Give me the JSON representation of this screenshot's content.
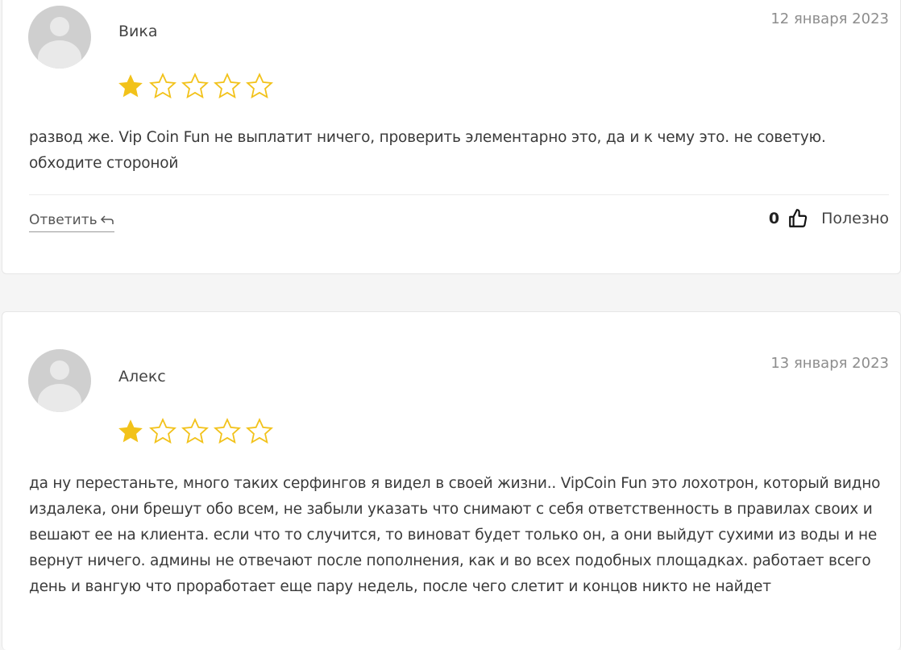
{
  "reviews": [
    {
      "author": "Вика",
      "date": "12 января 2023",
      "rating": 1,
      "max_rating": 5,
      "text": "развод же. Vip Coin Fun не выплатит ничего, проверить элементарно это, да и к чему это. не советую. обходите стороной",
      "reply_label": "Ответить",
      "useful_count": "0",
      "useful_label": "Полезно"
    },
    {
      "author": "Алекс",
      "date": "13 января 2023",
      "rating": 1,
      "max_rating": 5,
      "text": "да ну перестаньте, много таких серфингов я видел в своей жизни.. VipCoin Fun это лохотрон, который видно издалека, они брешут обо всем, не забыли указать что снимают с себя ответственность в правилах своих и вешают ее на клиента. если что то случится, то виноват будет только он, а они выйдут сухими из воды и не вернут ничего. админы не отвечают после пополнения, как и во всех подобных площадках. работает всего день и вангую что проработает еще пару недель, после чего слетит и концов никто не найдет"
    }
  ],
  "colors": {
    "star_filled": "#f2c21a",
    "star_empty": "#f2c21a"
  }
}
